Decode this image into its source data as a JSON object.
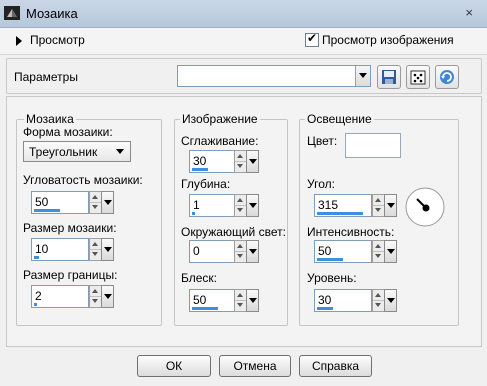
{
  "window": {
    "title": "Мозаика",
    "close_glyph": "×"
  },
  "preview": {
    "label": "Просмотр",
    "show_image_label": "Просмотр изображения",
    "show_image_checked": true
  },
  "params": {
    "label": "Параметры",
    "value": "",
    "icons": [
      "save-icon",
      "dice-icon",
      "reset-icon"
    ]
  },
  "mosaic": {
    "title": "Мозаика",
    "shape_label": "Форма мозаики:",
    "shape_value": "Треугольник",
    "angularity_label": "Угловатость мозаики:",
    "angularity_value": "50",
    "angularity_level": 0.5,
    "size_label": "Размер мозаики:",
    "size_value": "10",
    "size_level": 0.1,
    "border_label": "Размер границы:",
    "border_value": "2",
    "border_level": 0.05
  },
  "image": {
    "title": "Изображение",
    "smoothing_label": "Сглаживание:",
    "smoothing_value": "30",
    "smoothing_level": 0.3,
    "depth_label": "Глубина:",
    "depth_value": "1",
    "depth_level": 0.05,
    "ambient_label": "Окружающий свет:",
    "ambient_value": "0",
    "ambient_level": 0.0,
    "gloss_label": "Блеск:",
    "gloss_value": "50",
    "gloss_level": 0.5
  },
  "lighting": {
    "title": "Освещение",
    "color_label": "Цвет:",
    "color_value": "#ffffff",
    "angle_label": "Угол:",
    "angle_value": "315",
    "angle_level": 0.88,
    "intensity_label": "Интенсивность:",
    "intensity_value": "50",
    "intensity_level": 0.5,
    "level_label": "Уровень:",
    "level_value": "30",
    "level_level": 0.3
  },
  "buttons": {
    "ok": "ОК",
    "cancel": "Отмена",
    "help": "Справка"
  },
  "colors": {
    "accent_bar": "#3d8fe0",
    "title_bar": "#c3d2e4"
  }
}
